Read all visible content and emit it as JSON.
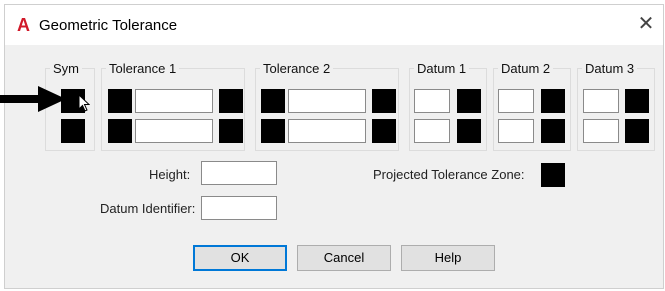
{
  "window": {
    "title": "Geometric Tolerance",
    "app_icon": "A",
    "close_glyph": "╳"
  },
  "groups": {
    "sym": "Sym",
    "tolerance1": "Tolerance 1",
    "tolerance2": "Tolerance 2",
    "datum1": "Datum 1",
    "datum2": "Datum 2",
    "datum3": "Datum 3"
  },
  "fields": {
    "height_label": "Height:",
    "height_value": "",
    "datum_identifier_label": "Datum Identifier:",
    "datum_identifier_value": "",
    "projected_zone_label": "Projected Tolerance Zone:"
  },
  "buttons": {
    "ok": "OK",
    "cancel": "Cancel",
    "help": "Help"
  },
  "colors": {
    "swatch": "#000000",
    "arrow": "#000000",
    "app_icon": "#d11a2a"
  }
}
